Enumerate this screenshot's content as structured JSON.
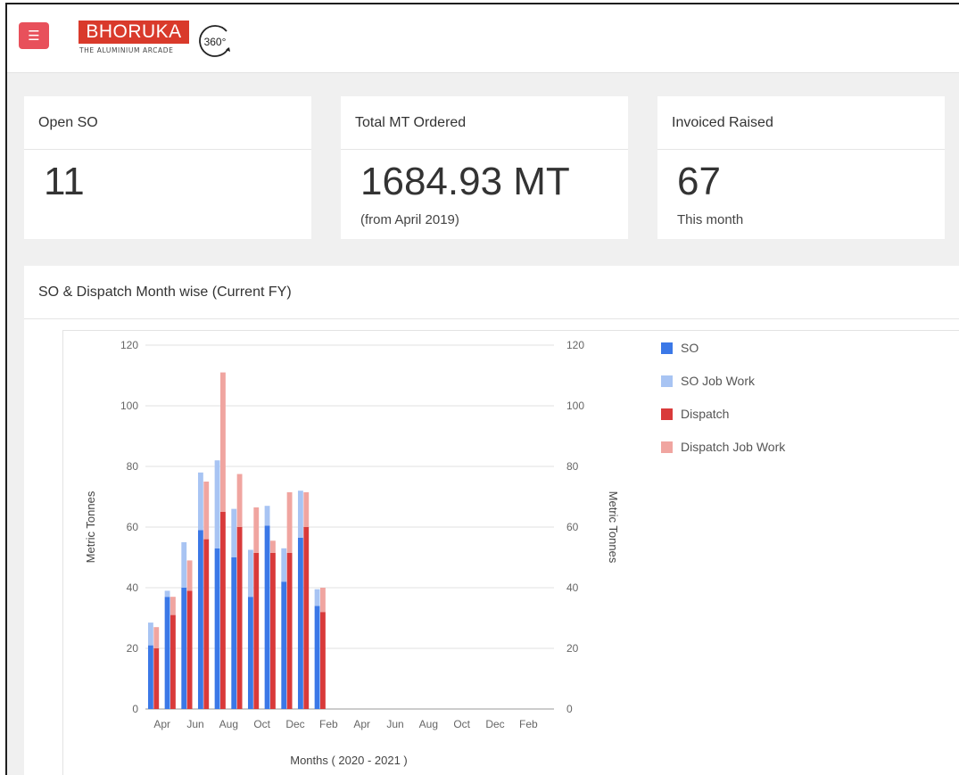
{
  "header": {
    "menu_icon": "hamburger-menu-icon",
    "logo_text": "BHORUKA",
    "logo_subtext": "THE ALUMINIUM ARCADE",
    "logo_badge": "360°",
    "colors": {
      "menu_button": "#e8505b",
      "logo": "#d93a2b"
    }
  },
  "cards": [
    {
      "title": "Open SO",
      "value": "11",
      "note": ""
    },
    {
      "title": "Total MT Ordered",
      "value": "1684.93 MT",
      "note": "(from April 2019)"
    },
    {
      "title": "Invoiced Raised",
      "value": "67",
      "note": "This month"
    }
  ],
  "chart_panel": {
    "title": "SO & Dispatch Month wise (Current FY)"
  },
  "chart_data": {
    "type": "bar",
    "categories": [
      "Apr",
      "May",
      "Jun",
      "Jul",
      "Aug",
      "Sep",
      "Oct",
      "Nov",
      "Dec",
      "Jan",
      "Feb",
      "Mar",
      "Apr",
      "May",
      "Jun",
      "Jul",
      "Aug",
      "Sep",
      "Oct",
      "Nov",
      "Dec",
      "Jan",
      "Feb",
      "Mar"
    ],
    "tick_labels": [
      "Apr",
      "Jun",
      "Aug",
      "Oct",
      "Dec",
      "Feb",
      "Apr",
      "Jun",
      "Aug",
      "Oct",
      "Dec",
      "Feb"
    ],
    "series": [
      {
        "name": "SO",
        "color": "#3b78e7",
        "stack": "so",
        "values": [
          21,
          37,
          40,
          59,
          53,
          50,
          37,
          60.5,
          42,
          56.5,
          34
        ]
      },
      {
        "name": "SO Job Work",
        "color": "#a8c4f3",
        "stack": "so",
        "values": [
          7.5,
          2,
          15,
          19,
          29,
          16,
          15.5,
          6.5,
          11,
          15.5,
          5.5
        ]
      },
      {
        "name": "Dispatch",
        "color": "#d93a3a",
        "stack": "dispatch",
        "values": [
          20,
          31,
          39,
          56,
          65,
          60,
          51.5,
          51.5,
          51.5,
          60,
          32
        ]
      },
      {
        "name": "Dispatch Job Work",
        "color": "#f0a5a0",
        "stack": "dispatch",
        "values": [
          7,
          6,
          10,
          19,
          46,
          17.5,
          15,
          4,
          20,
          11.5,
          8
        ]
      }
    ],
    "xlabel": "Months ( 2020 - 2021 )",
    "ylabel": "Metric Tonnes",
    "ylabel_right": "Metric Tonnes",
    "ylim": [
      0,
      120
    ],
    "y_ticks": [
      "0",
      "20",
      "40",
      "60",
      "80",
      "100",
      "120"
    ],
    "grid": true,
    "legend": "right"
  }
}
